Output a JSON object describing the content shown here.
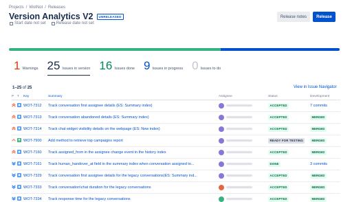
{
  "breadcrumb": [
    "Projects",
    "/",
    "WotNot",
    "/",
    "Releases"
  ],
  "page_title": "Version Analytics V2",
  "release_badge": "UNRELEASED",
  "dates": {
    "start": "Start date not set",
    "release": "Release date not set"
  },
  "buttons": {
    "release_notes": "Release notes",
    "release": "Release"
  },
  "progress": {
    "done_fraction": 0.64,
    "in_progress_fraction": 0.36,
    "done_color": "#36b37e",
    "in_progress_color": "#0052cc"
  },
  "stats": [
    {
      "num": "1",
      "label": "Warnings",
      "color": "#de350b"
    },
    {
      "num": "25",
      "label": "Issues in version",
      "color": "#172b4d"
    },
    {
      "num": "16",
      "label": "Issues done",
      "color": "#00875a"
    },
    {
      "num": "9",
      "label": "Issues in progress",
      "color": "#0052cc"
    },
    {
      "num": "0",
      "label": "Issues to do",
      "color": "#c1c7d0"
    }
  ],
  "count_range": "1–25",
  "count_of": "of",
  "count_total": "25",
  "navigator_link": "View in Issue Navigator",
  "columns": [
    "P",
    "T",
    "Key",
    "Summary",
    "Assignee",
    "Status",
    "Development"
  ],
  "issues": [
    {
      "priority": "highest",
      "type": "story",
      "key": "WOT-7312",
      "summary": "Track conversation first assignee details (ES: Summary index)",
      "status": "ACCEPTED",
      "status_kind": "accepted",
      "dev": "7 commits",
      "dev_kind": "commits",
      "avatar_color": "#8777d9"
    },
    {
      "priority": "highest",
      "type": "story",
      "key": "WOT-7313",
      "summary": "Track conversation abandoned details (ES: Summary index)",
      "status": "ACCEPTED",
      "status_kind": "accepted",
      "dev": "MERGED",
      "dev_kind": "merged",
      "avatar_color": "#8777d9"
    },
    {
      "priority": "highest",
      "type": "story",
      "key": "WOT-7314",
      "summary": "Track chat widget visibility details on the webpage (ES: New index)",
      "status": "ACCEPTED",
      "status_kind": "accepted",
      "dev": "MERGED",
      "dev_kind": "merged",
      "avatar_color": "#8777d9"
    },
    {
      "priority": "high",
      "type": "improvement",
      "key": "WOT-7900",
      "summary": "Add method to retrieve top campaigns report",
      "status": "READY FOR TESTING",
      "status_kind": "ready",
      "dev": "MERGED",
      "dev_kind": "merged",
      "avatar_color": "#8777d9"
    },
    {
      "priority": "highest",
      "type": "story",
      "key": "WOT-7160",
      "summary": "Track assigned_from in the assignee change event in the history index",
      "status": "ACCEPTED",
      "status_kind": "accepted",
      "dev": "MERGED",
      "dev_kind": "merged",
      "avatar_color": "#8777d9"
    },
    {
      "priority": "lowest",
      "type": "story",
      "key": "WOT-7161",
      "summary": "Track human_handover_at field in the summary index when conversation assigned to...",
      "status": "DONE",
      "status_kind": "done",
      "dev": "3 commits",
      "dev_kind": "commits",
      "avatar_color": "#8777d9"
    },
    {
      "priority": "lowest",
      "type": "story",
      "key": "WOT-7329",
      "summary": "Track conversation first assignee details for the legacy conversations(ES: Summary ind...",
      "status": "ACCEPTED",
      "status_kind": "accepted",
      "dev": "MERGED",
      "dev_kind": "merged",
      "avatar_color": "#8777d9"
    },
    {
      "priority": "lowest",
      "type": "story",
      "key": "WOT-7333",
      "summary": "Track conversation\\chat duration for the legacy conversations",
      "status": "ACCEPTED",
      "status_kind": "accepted",
      "dev": "MERGED",
      "dev_kind": "merged",
      "avatar_color": "#e8643d"
    },
    {
      "priority": "lowest",
      "type": "story",
      "key": "WOT-7334",
      "summary": "Track response time for the legacy conversations",
      "status": "ACCEPTED",
      "status_kind": "accepted",
      "dev": "MERGED",
      "dev_kind": "merged",
      "avatar_color": "#36b37e"
    }
  ]
}
